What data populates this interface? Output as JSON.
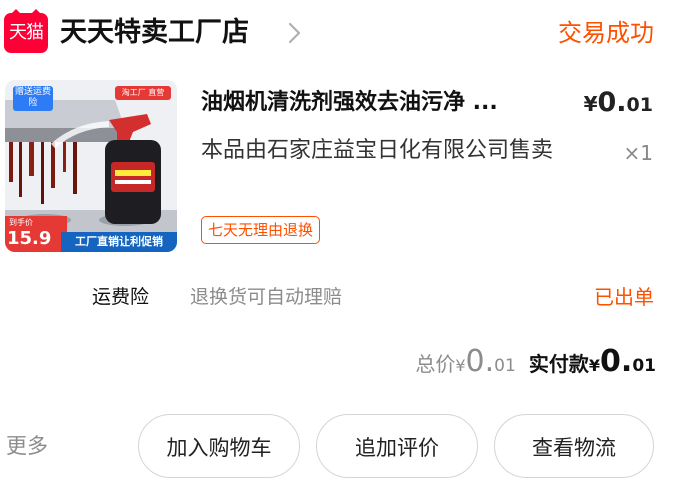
{
  "shop": {
    "logo_text": "天猫",
    "name": "天天特卖工厂店",
    "status": "交易成功"
  },
  "product": {
    "image": {
      "badge_tl": "赠送运费险",
      "badge_tr": "淘工厂 直营",
      "price_label": "到手价",
      "price_value": "15.9",
      "banner": "工厂直销让利促销"
    },
    "title": "油烟机清洗剂强效去油污净 ...",
    "price": {
      "currency": "¥",
      "integer": "0.",
      "decimal": "01"
    },
    "seller_note": "本品由石家庄益宝日化有限公司售卖",
    "quantity": "×1",
    "return_tag": "七天无理由退换"
  },
  "insurance": {
    "label": "运费险",
    "description": "退换货可自动理赔",
    "status": "已出单"
  },
  "totals": {
    "total_label": "总价",
    "total_currency": "¥",
    "total_integer": "0.",
    "total_decimal": "01",
    "paid_label": "实付款",
    "paid_currency": "¥",
    "paid_integer": "0.",
    "paid_decimal": "01"
  },
  "actions": {
    "more": "更多",
    "add_to_cart": "加入购物车",
    "add_review": "追加评价",
    "view_logistics": "查看物流"
  },
  "colors": {
    "accent": "#ff5000",
    "tmall_red": "#ff0036"
  }
}
